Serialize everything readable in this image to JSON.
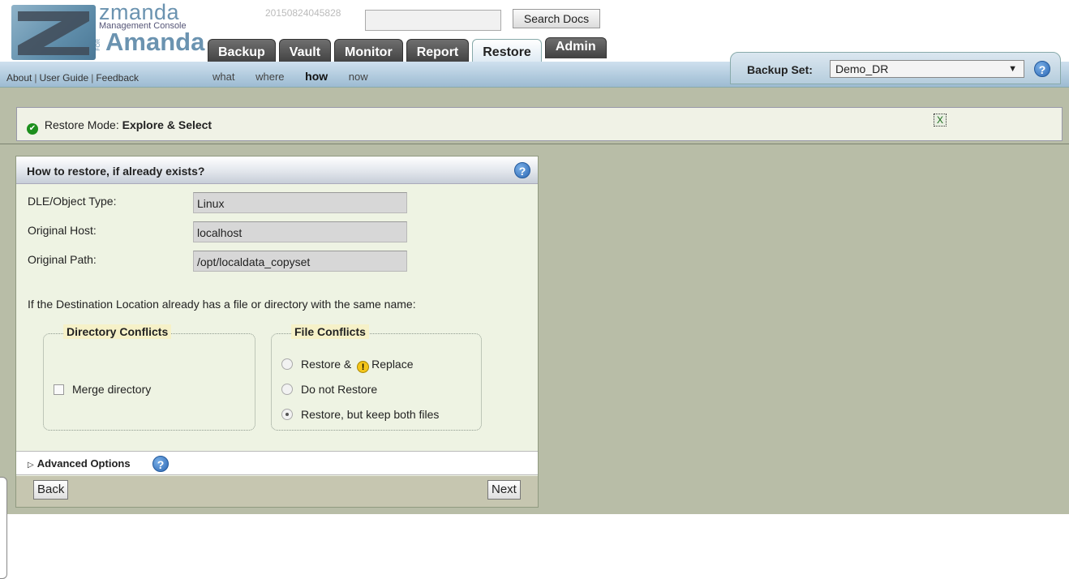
{
  "header": {
    "logo": {
      "brand": "zmanda",
      "subtitle": "Management Console",
      "for": "FOR",
      "product": "Amanda"
    },
    "build_id": "20150824045828",
    "search": {
      "value": "",
      "button_label": "Search Docs"
    },
    "tabs": [
      {
        "label": "Backup",
        "active": false
      },
      {
        "label": "Vault",
        "active": false
      },
      {
        "label": "Monitor",
        "active": false
      },
      {
        "label": "Report",
        "active": false
      },
      {
        "label": "Restore",
        "active": true
      },
      {
        "label": "Admin",
        "active": false
      }
    ],
    "help_links": [
      "About",
      "User Guide",
      "Feedback"
    ],
    "wizard_steps": [
      {
        "label": "what",
        "current": false
      },
      {
        "label": "where",
        "current": false
      },
      {
        "label": "how",
        "current": true
      },
      {
        "label": "now",
        "current": false
      }
    ],
    "backup_set": {
      "label": "Backup Set:",
      "value": "Demo_DR",
      "help": "?"
    }
  },
  "mode_bar": {
    "prefix": "Restore Mode:",
    "mode": "Explore & Select",
    "close_label": "X",
    "check_icon": "check-circle-icon"
  },
  "panel": {
    "title": "How to restore, if already exists?",
    "help": "?",
    "fields": [
      {
        "label": "DLE/Object Type:",
        "value": "Linux"
      },
      {
        "label": "Original Host:",
        "value": "localhost"
      },
      {
        "label": "Original Path:",
        "value": "/opt/localdata_copyset"
      }
    ],
    "conflict_prompt": "If the Destination Location already has a file or directory with the same name:",
    "directory_conflicts": {
      "legend": "Directory Conflicts",
      "options": [
        {
          "label": "Merge directory",
          "checked": false
        }
      ]
    },
    "file_conflicts": {
      "legend": "File Conflicts",
      "options": [
        {
          "label_before": "Restore &",
          "label_after": "Replace",
          "warning_icon": "!",
          "selected": false
        },
        {
          "label": "Do not Restore",
          "selected": false
        },
        {
          "label": "Restore, but keep both files",
          "selected": true
        }
      ]
    },
    "advanced": {
      "label": "Advanced Options",
      "help": "?"
    },
    "back_label": "Back",
    "next_label": "Next"
  },
  "colors": {
    "content_bg": "#b8bda7",
    "panel_bg": "#eef3e3",
    "tab_dark": "#4a4a4a",
    "navbar_blue": "#b0cadd",
    "legend_bg": "#f6f1c8",
    "help_blue": "#2c67b3",
    "status_green": "#1d8f1d"
  }
}
